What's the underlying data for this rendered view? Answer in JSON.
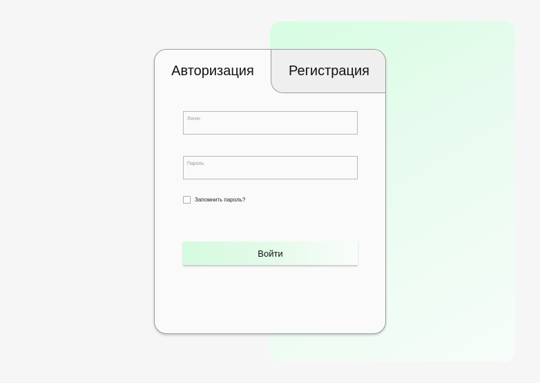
{
  "tabs": {
    "login": "Авторизация",
    "register": "Регистрация"
  },
  "form": {
    "login_label": "Логин",
    "login_value": "",
    "password_label": "Пароль",
    "password_value": "",
    "remember_label": "Запомнить пароль?",
    "remember_checked": false,
    "submit_label": "Войти"
  },
  "colors": {
    "accent_green": "#d6fde2",
    "card_background": "#fafafa",
    "inactive_tab": "#efefef"
  }
}
